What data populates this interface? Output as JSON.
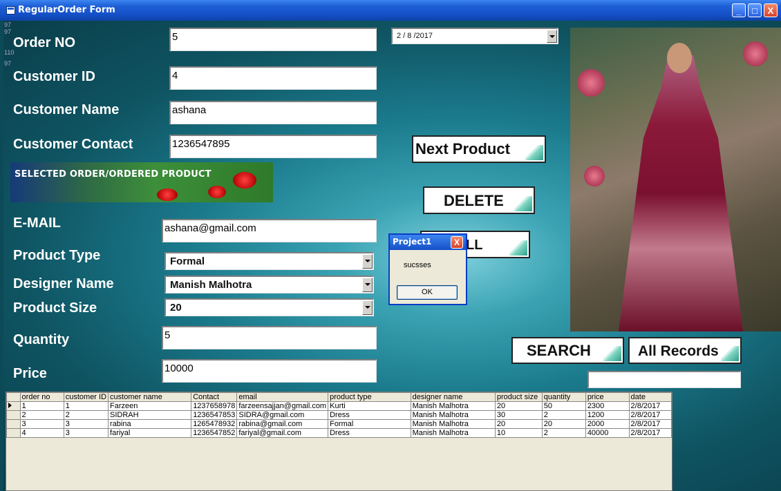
{
  "window": {
    "title": "RegularOrder Form",
    "minimize": "_",
    "maximize": "□",
    "close": "X"
  },
  "tiny_numbers": [
    "97",
    "97",
    "110",
    "97"
  ],
  "labels": {
    "order_no": "Order NO",
    "customer_id": "Customer ID",
    "customer_name": "Customer Name",
    "customer_contact": "Customer Contact",
    "email": "E-MAIL",
    "product_type": "Product Type",
    "designer_name": "Designer Name",
    "product_size": "Product Size",
    "quantity": "Quantity",
    "price": "Price"
  },
  "fields": {
    "order_no": "5",
    "customer_id": "4",
    "customer_name": "ashana",
    "customer_contact": "1236547895",
    "email": "ashana@gmail.com",
    "quantity": "5",
    "price": "10000",
    "search": "",
    "date": "2 / 8 /2017"
  },
  "combos": {
    "product_type": "Formal",
    "designer_name": "Manish Malhotra",
    "product_size": "20"
  },
  "banner_text": "SELECTED ORDER/ORDERED PRODUCT",
  "buttons": {
    "next_product": "Next Product",
    "delete": "DELETE",
    "bill": "BILL",
    "search": "SEARCH",
    "all_records": "All Records"
  },
  "dialog": {
    "title": "Project1",
    "message": "sucsses",
    "ok": "OK",
    "close": "X"
  },
  "table": {
    "columns": [
      "order no",
      "customer ID",
      "customer name",
      "Contact",
      "email",
      "product type",
      "designer name",
      "product size",
      "quantity",
      "price",
      "date"
    ],
    "rows": [
      [
        "1",
        "1",
        "Farzeen",
        "1237658978",
        "farzeensajjan@gmail.com",
        "Kurti",
        "Manish Malhotra",
        "20",
        "50",
        "2300",
        "2/8/2017"
      ],
      [
        "2",
        "2",
        "SIDRAH",
        "1236547853",
        "SIDRA@gmail.com",
        "Dress",
        "Manish Malhotra",
        "30",
        "2",
        "1200",
        "2/8/2017"
      ],
      [
        "3",
        "3",
        "rabina",
        "1265478932",
        "rabina@gmail.com",
        "Formal",
        "Manish Malhotra",
        "20",
        "20",
        "2000",
        "2/8/2017"
      ],
      [
        "4",
        "3",
        "fariyal",
        "1236547852",
        "fariyal@gmail.com",
        "Dress",
        "Manish Malhotra",
        "10",
        "2",
        "40000",
        "2/8/2017"
      ]
    ]
  }
}
